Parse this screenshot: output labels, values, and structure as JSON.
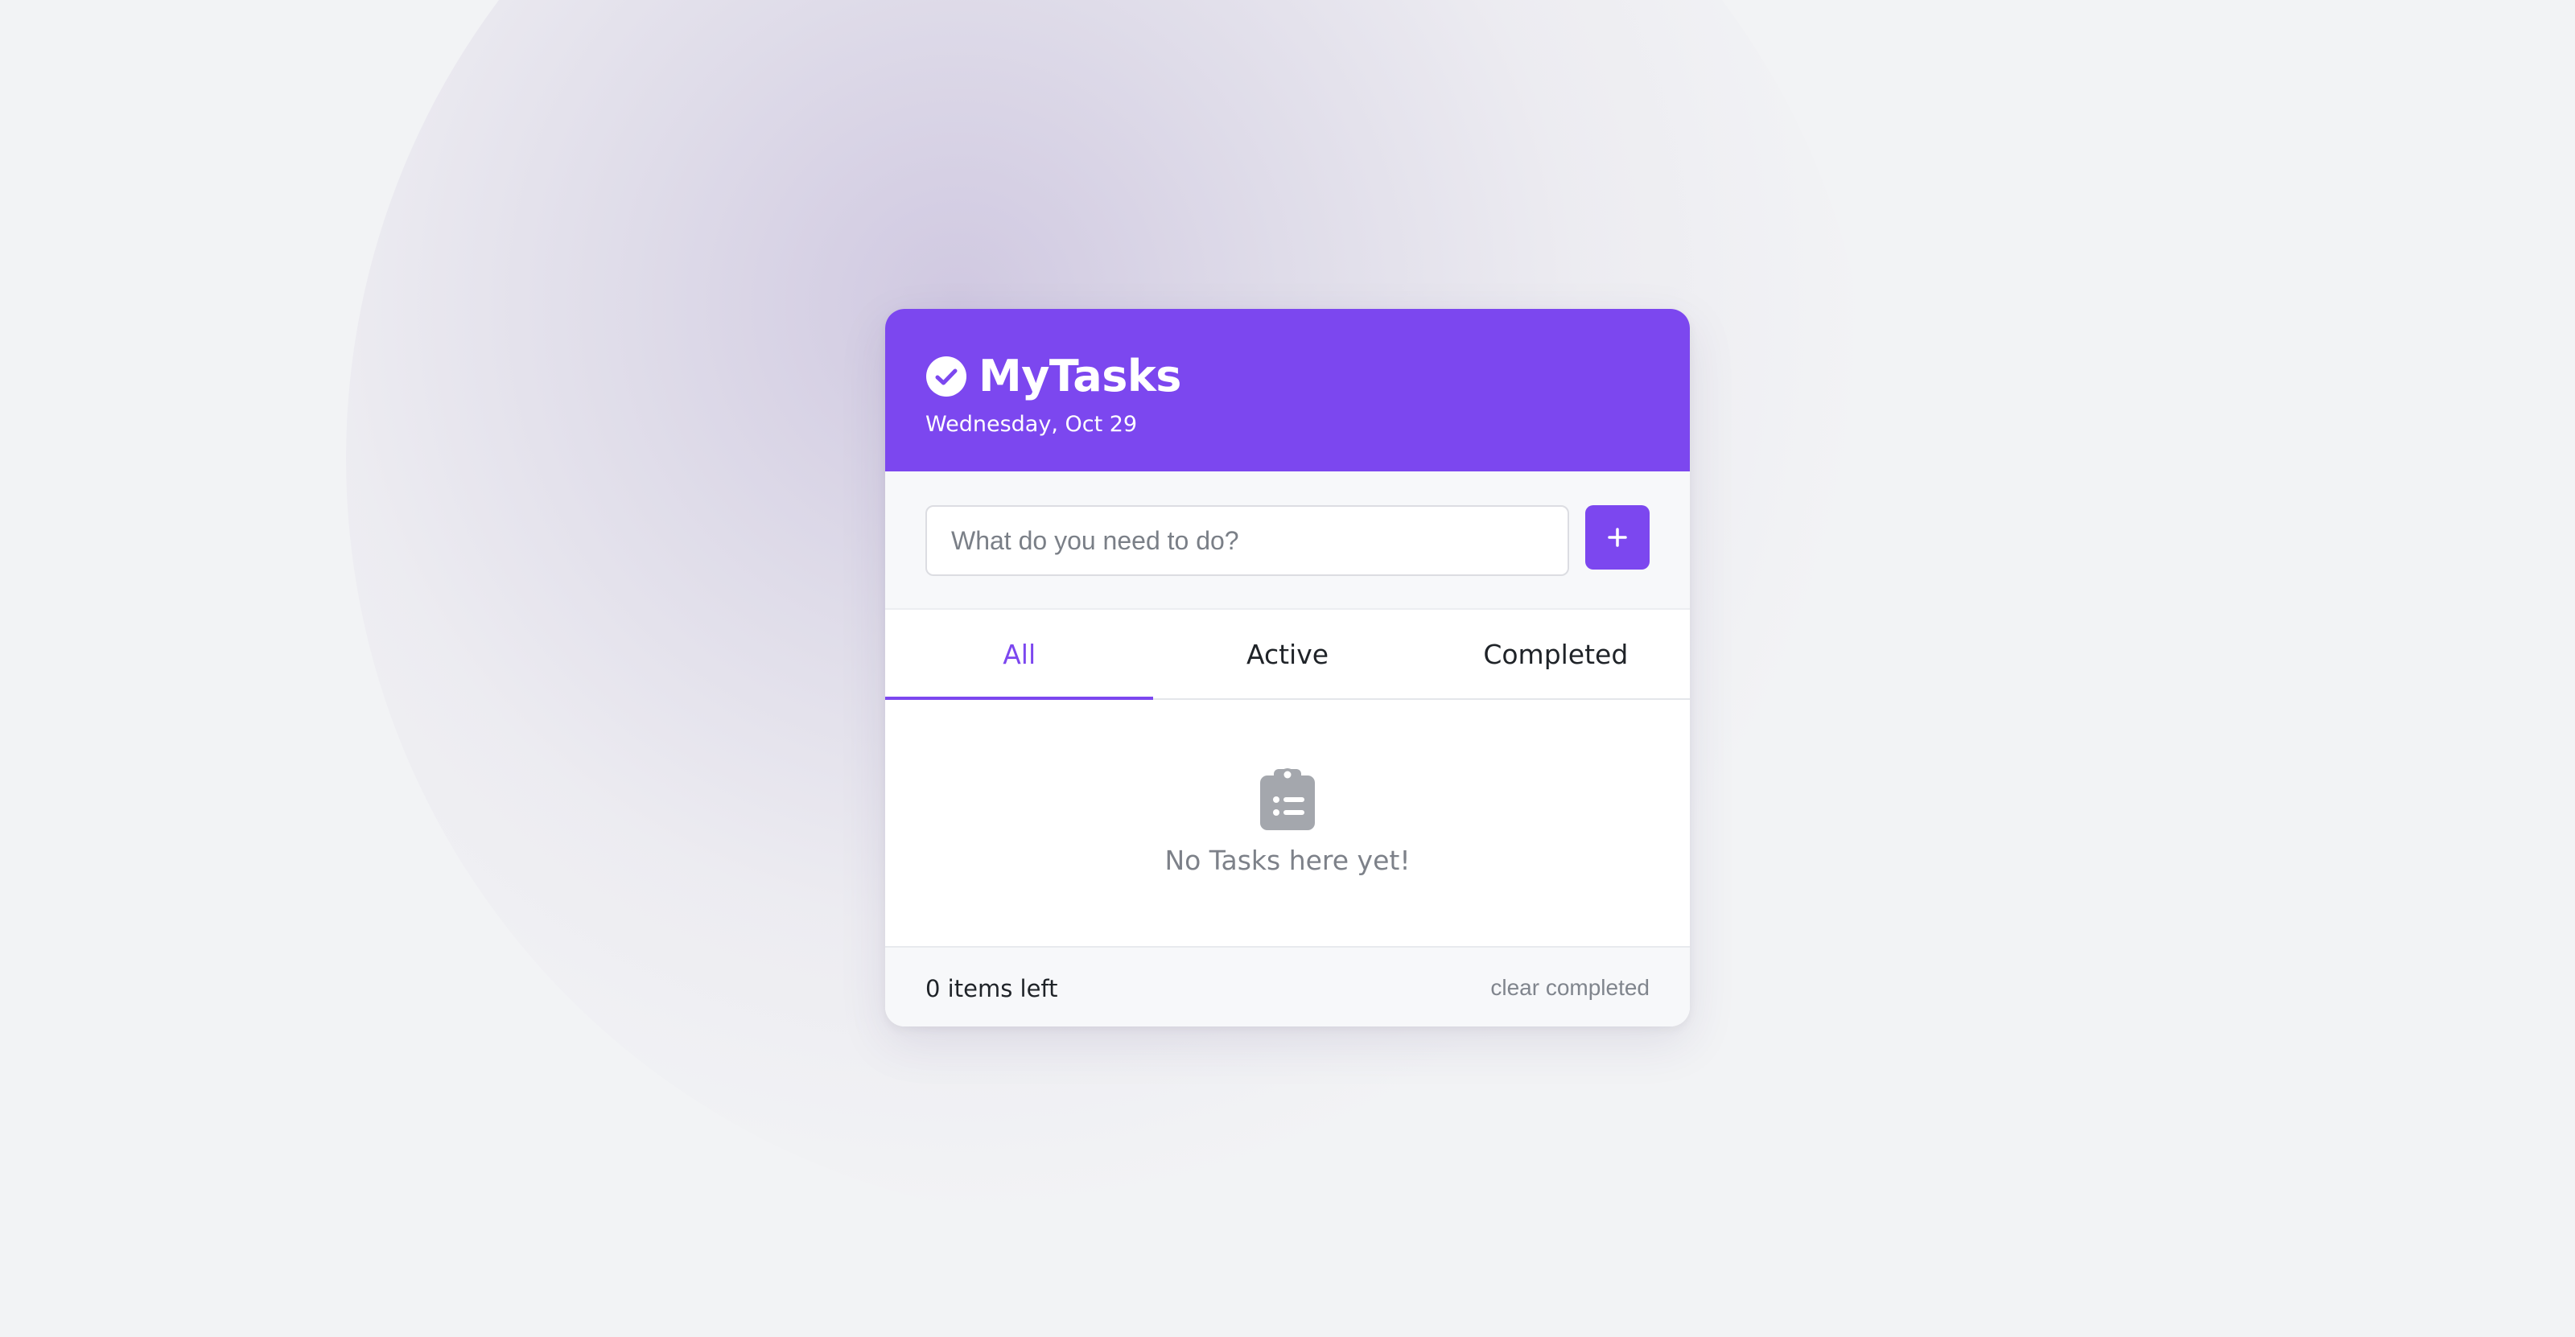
{
  "app": {
    "title": "MyTasks",
    "date": "Wednesday, Oct 29",
    "accent_color": "#7c47ef"
  },
  "input": {
    "placeholder": "What do you need to do?",
    "value": "",
    "add_button_icon": "plus-icon"
  },
  "tabs": [
    {
      "label": "All",
      "active": true
    },
    {
      "label": "Active",
      "active": false
    },
    {
      "label": "Completed",
      "active": false
    }
  ],
  "empty_state": {
    "icon": "clipboard-list-icon",
    "message": "No Tasks here yet!"
  },
  "footer": {
    "items_left": "0 items left",
    "clear_label": "clear completed"
  }
}
